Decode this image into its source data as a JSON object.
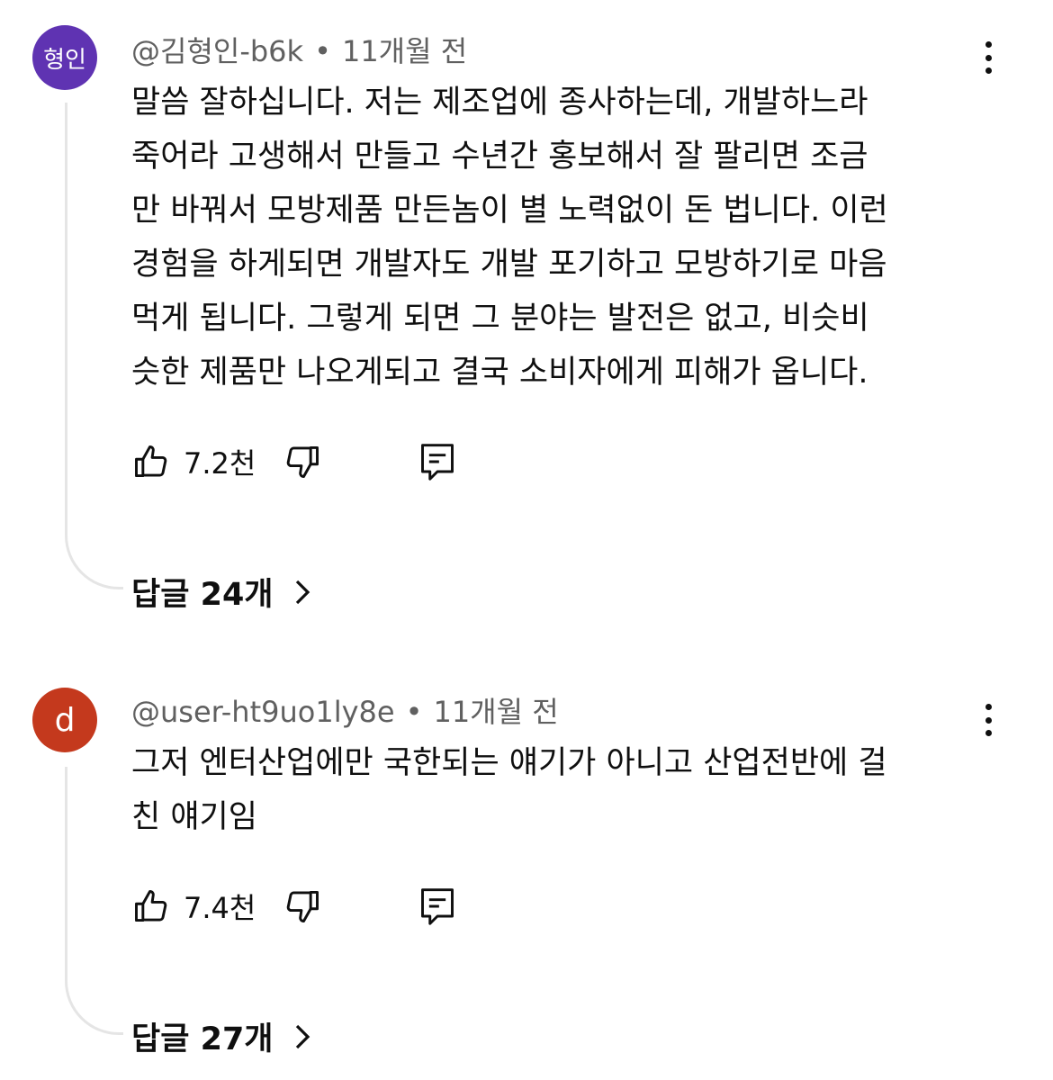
{
  "comments": [
    {
      "avatar_text": "형인",
      "avatar_color": "#5f33b2",
      "author": "@김형인-b6k",
      "time": "11개월 전",
      "text": "말씀 잘하십니다. 저는 제조업에 종사하는데, 개발하느라\n죽어라 고생해서 만들고 수년간 홍보해서 잘 팔리면 조금\n만 바꿔서 모방제품 만든놈이 별 노력없이 돈 법니다. 이런\n경험을 하게되면 개발자도 개발 포기하고 모방하기로 마음\n먹게 됩니다. 그렇게 되면  그 분야는  발전은 없고, 비슷비\n슷한 제품만 나오게되고 결국 소비자에게 피해가 옵니다.",
      "likes": "7.2천",
      "replies": "답글 24개"
    },
    {
      "avatar_text": "d",
      "avatar_color": "#c4391d",
      "author": "@user-ht9uo1ly8e",
      "time": "11개월 전",
      "text": "그저 엔터산업에만 국한되는 얘기가 아니고 산업전반에 걸\n친 얘기임",
      "likes": "7.4천",
      "replies": "답글 27개"
    }
  ],
  "separator": "•",
  "icons": [
    "thumb-up-icon",
    "thumb-down-icon",
    "reply-icon",
    "more-vert-icon",
    "chevron-right-icon"
  ]
}
